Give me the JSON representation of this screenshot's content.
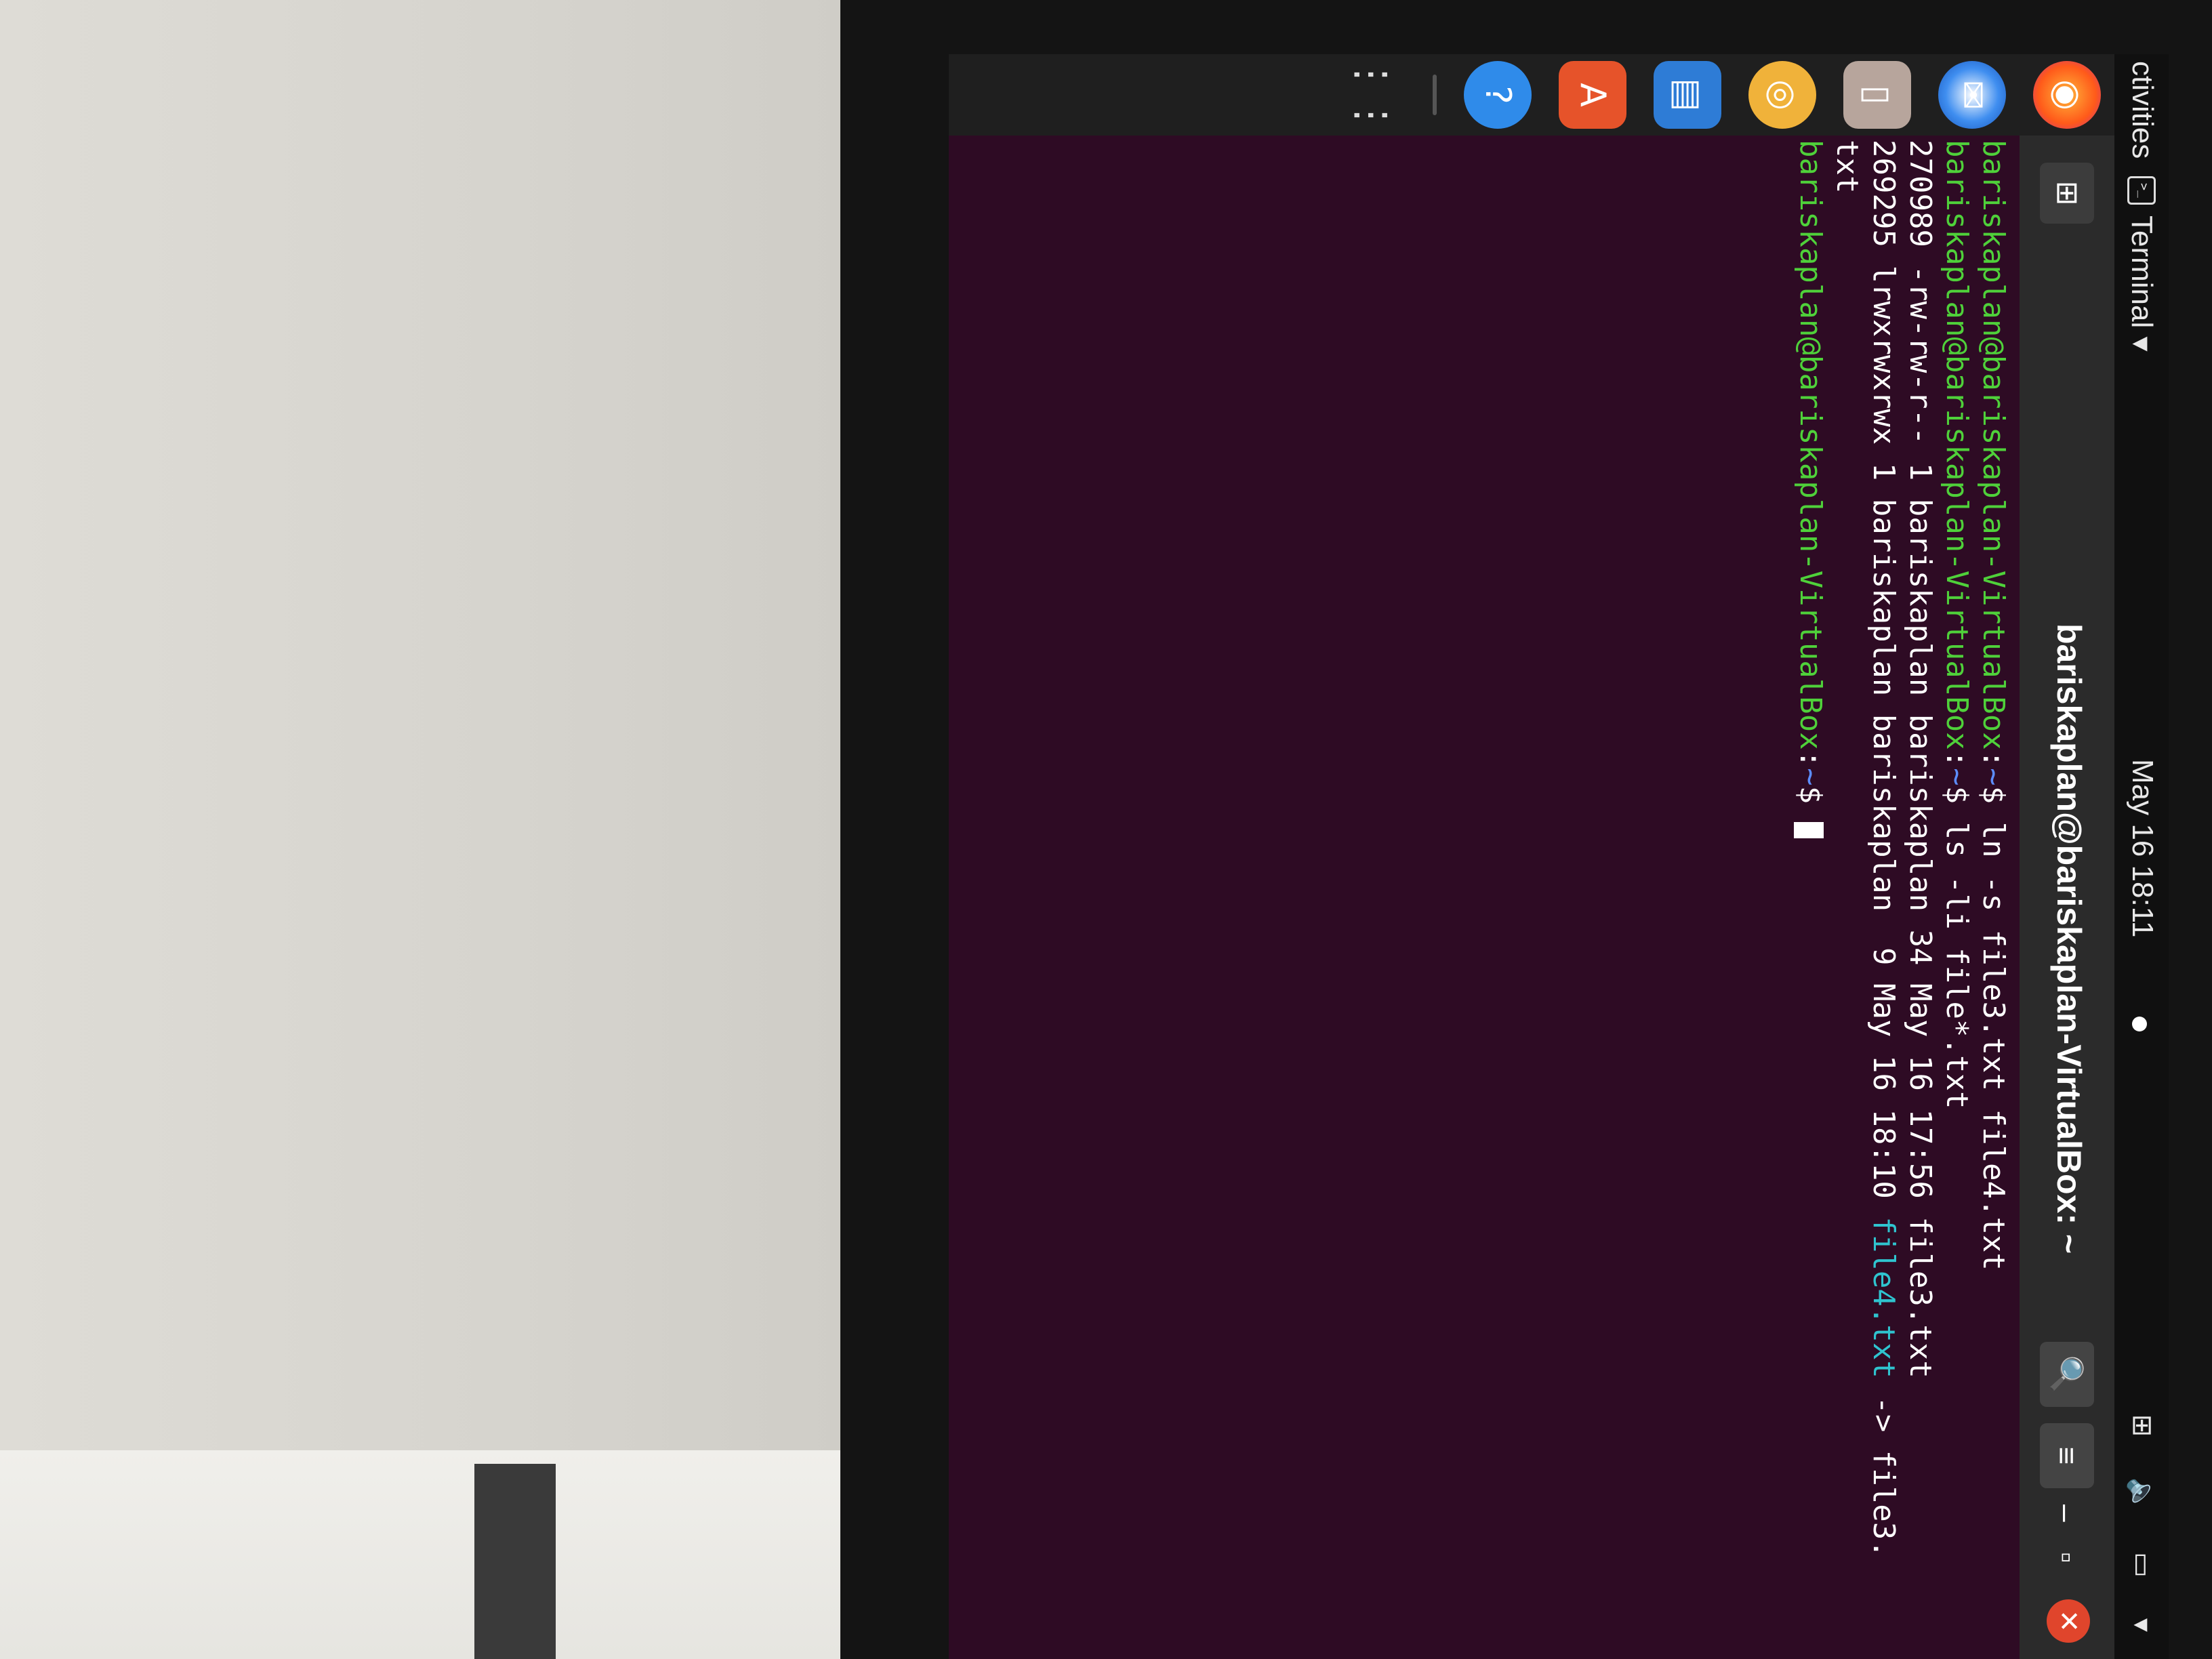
{
  "topbar": {
    "activities": "ctivities",
    "app_menu": "Terminal ▾",
    "clock": "May 16 18:11",
    "tray_icons": [
      "network-icon",
      "volume-icon",
      "battery-icon",
      "dropdown-icon"
    ]
  },
  "headerbar": {
    "title": "bariskaplan@bariskaplan-VirtualBox: ~",
    "new_tab": "⊞",
    "search": "🔍",
    "menu": "≡",
    "minimize": "–",
    "maximize": "▫",
    "close": "✕"
  },
  "terminal": {
    "prompt_user": "bariskaplan@bariskaplan-VirtualBox",
    "prompt_sep": ":",
    "prompt_path": "~",
    "prompt_suffix": "$ ",
    "lines": [
      {
        "cmd": "ln -s file3.txt file4.txt"
      },
      {
        "cmd": "ls -li file*.txt"
      }
    ],
    "output1": "270989 -rw-rw-r-- 1 bariskaplan bariskaplan 34 May 16 17:56 file3.txt",
    "output2_prefix": "269295 lrwxrwxrwx 1 bariskaplan bariskaplan  9 May 16 18:10 ",
    "output2_link": "file4.txt",
    "output2_suffix": " -> file3.",
    "output3": "txt"
  },
  "dock": {
    "items": [
      "firefox-icon",
      "thunderbird-icon",
      "files-icon",
      "rhythmbox-icon",
      "libreoffice-writer-icon",
      "ubuntu-software-icon",
      "help-icon",
      "show-applications-icon"
    ]
  }
}
